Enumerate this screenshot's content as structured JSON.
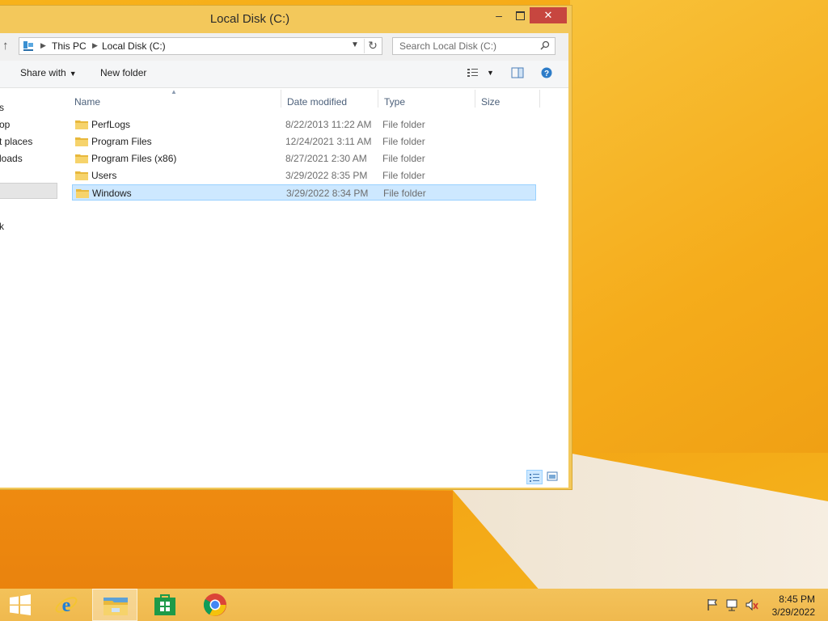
{
  "window": {
    "title": "Local Disk (C:)",
    "minimize": "–",
    "close": "✕"
  },
  "address": {
    "crumbs": [
      "This PC",
      "Local Disk (C:)"
    ],
    "search_placeholder": "Search Local Disk (C:)"
  },
  "toolbar": {
    "share_with": "Share with",
    "new_folder": "New folder"
  },
  "nav": {
    "items": [
      "s",
      "op",
      "t places",
      "loads",
      "",
      "k"
    ]
  },
  "columns": {
    "name": "Name",
    "date": "Date modified",
    "type": "Type",
    "size": "Size"
  },
  "files": [
    {
      "name": "PerfLogs",
      "date": "8/22/2013 11:22 AM",
      "type": "File folder"
    },
    {
      "name": "Program Files",
      "date": "12/24/2021 3:11 AM",
      "type": "File folder"
    },
    {
      "name": "Program Files (x86)",
      "date": "8/27/2021 2:30 AM",
      "type": "File folder"
    },
    {
      "name": "Users",
      "date": "3/29/2022 8:35 PM",
      "type": "File folder"
    },
    {
      "name": "Windows",
      "date": "3/29/2022 8:34 PM",
      "type": "File folder",
      "selected": true
    }
  ],
  "taskbar": {
    "time": "8:45 PM",
    "date": "3/29/2022"
  },
  "colors": {
    "accent": "#f5a516",
    "selection": "#cde8ff",
    "close": "#c7463f"
  },
  "icons": [
    "windows-start-icon",
    "internet-explorer-icon",
    "file-explorer-icon",
    "store-icon",
    "chrome-icon",
    "flag-icon",
    "network-icon",
    "volume-muted-icon",
    "folder-icon",
    "search-icon",
    "refresh-icon",
    "up-arrow-icon",
    "help-icon"
  ]
}
